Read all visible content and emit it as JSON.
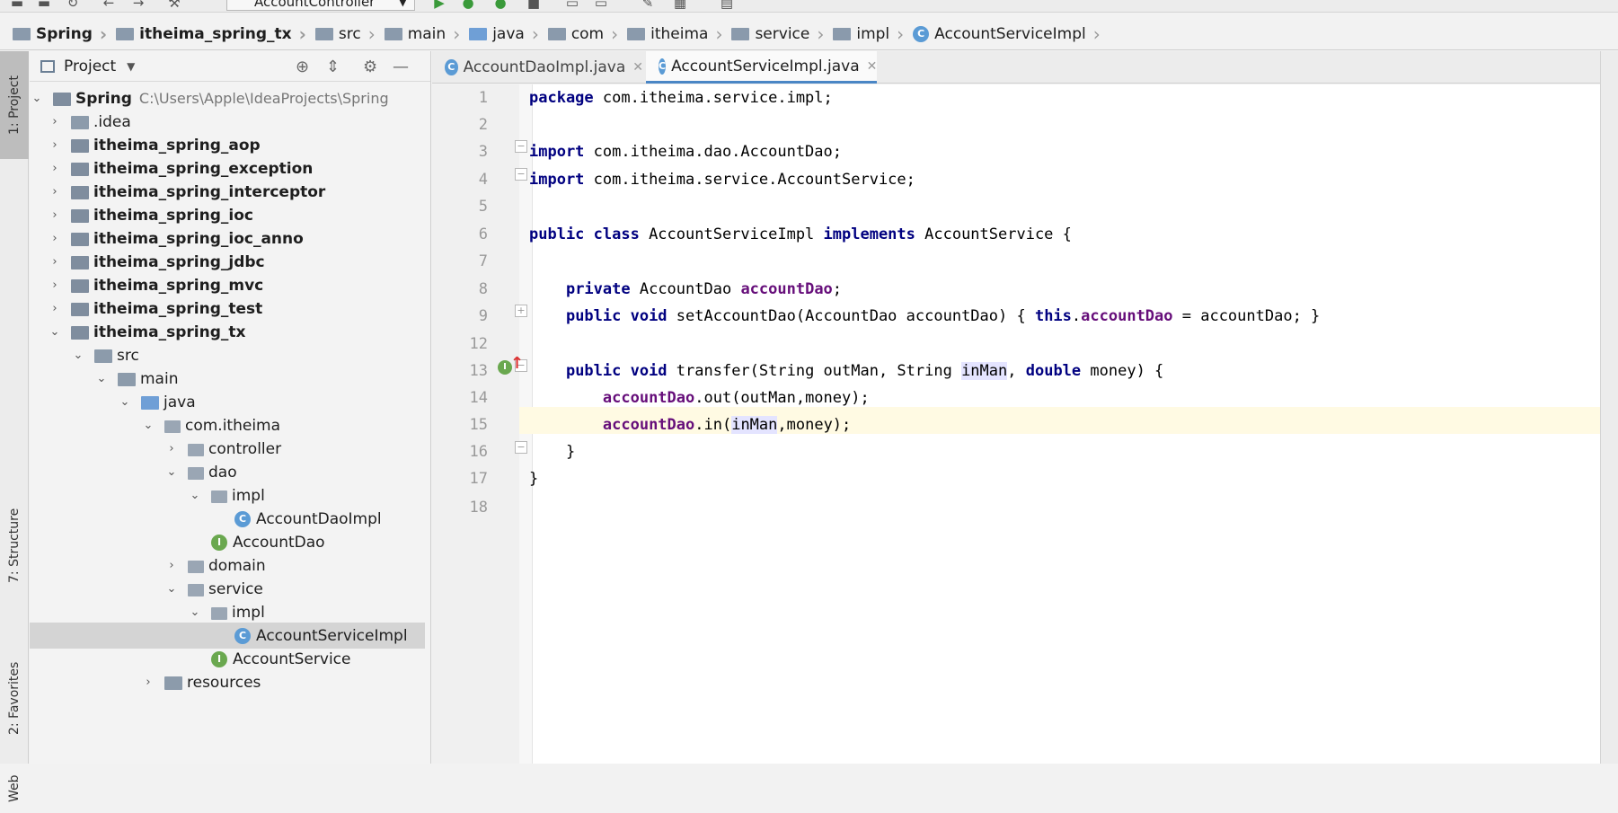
{
  "toolbar": {
    "run_config": "AccountController"
  },
  "breadcrumb": [
    {
      "label": "Spring",
      "bold": true
    },
    {
      "label": "itheima_spring_tx",
      "bold": true
    },
    {
      "label": "src"
    },
    {
      "label": "main"
    },
    {
      "label": "java"
    },
    {
      "label": "com"
    },
    {
      "label": "itheima"
    },
    {
      "label": "service"
    },
    {
      "label": "impl"
    },
    {
      "label": "AccountServiceImpl",
      "icon": "C"
    }
  ],
  "side_tabs": {
    "project": "1: Project",
    "structure": "7: Structure",
    "favorites": "2: Favorites",
    "web": "Web"
  },
  "project_panel": {
    "title": "Project",
    "root_name": "Spring",
    "root_path": "C:\\Users\\Apple\\IdeaProjects\\Spring",
    "items": [
      ".idea",
      "itheima_spring_aop",
      "itheima_spring_exception",
      "itheima_spring_interceptor",
      "itheima_spring_ioc",
      "itheima_spring_ioc_anno",
      "itheima_spring_jdbc",
      "itheima_spring_mvc",
      "itheima_spring_test",
      "itheima_spring_tx",
      "src",
      "main",
      "java",
      "com.itheima",
      "controller",
      "dao",
      "impl",
      "AccountDaoImpl",
      "AccountDao",
      "domain",
      "service",
      "impl",
      "AccountServiceImpl",
      "AccountService",
      "resources"
    ]
  },
  "tabs": [
    {
      "label": "AccountDaoImpl.java",
      "active": false
    },
    {
      "label": "AccountServiceImpl.java",
      "active": true
    }
  ],
  "editor": {
    "line_numbers": [
      "1",
      "2",
      "3",
      "4",
      "5",
      "6",
      "7",
      "8",
      "9",
      "12",
      "13",
      "14",
      "15",
      "16",
      "17",
      "18"
    ],
    "code": {
      "l1": [
        "package",
        " com.itheima.service.impl;"
      ],
      "l3": [
        "import",
        " com.itheima.dao.AccountDao;"
      ],
      "l4": [
        "import",
        " com.itheima.service.AccountService;"
      ],
      "l6": [
        "public class",
        " AccountServiceImpl ",
        "implements",
        " AccountService {"
      ],
      "l8": [
        "private",
        " AccountDao ",
        "accountDao",
        ";"
      ],
      "l9": [
        "public void",
        " setAccountDao(AccountDao accountDao) { ",
        "this",
        ".",
        "accountDao",
        " = accountDao; }"
      ],
      "l13": [
        "public void",
        " transfer(String outMan, String ",
        "inMan",
        ", ",
        "double",
        " money) {"
      ],
      "l14": [
        "accountDao",
        ".out(outMan,money);"
      ],
      "l15": [
        "accountDao",
        ".in(",
        "inMan",
        ",money);"
      ],
      "l16": [
        "}"
      ],
      "l17": [
        "}"
      ]
    },
    "gutter_icon": "I"
  }
}
